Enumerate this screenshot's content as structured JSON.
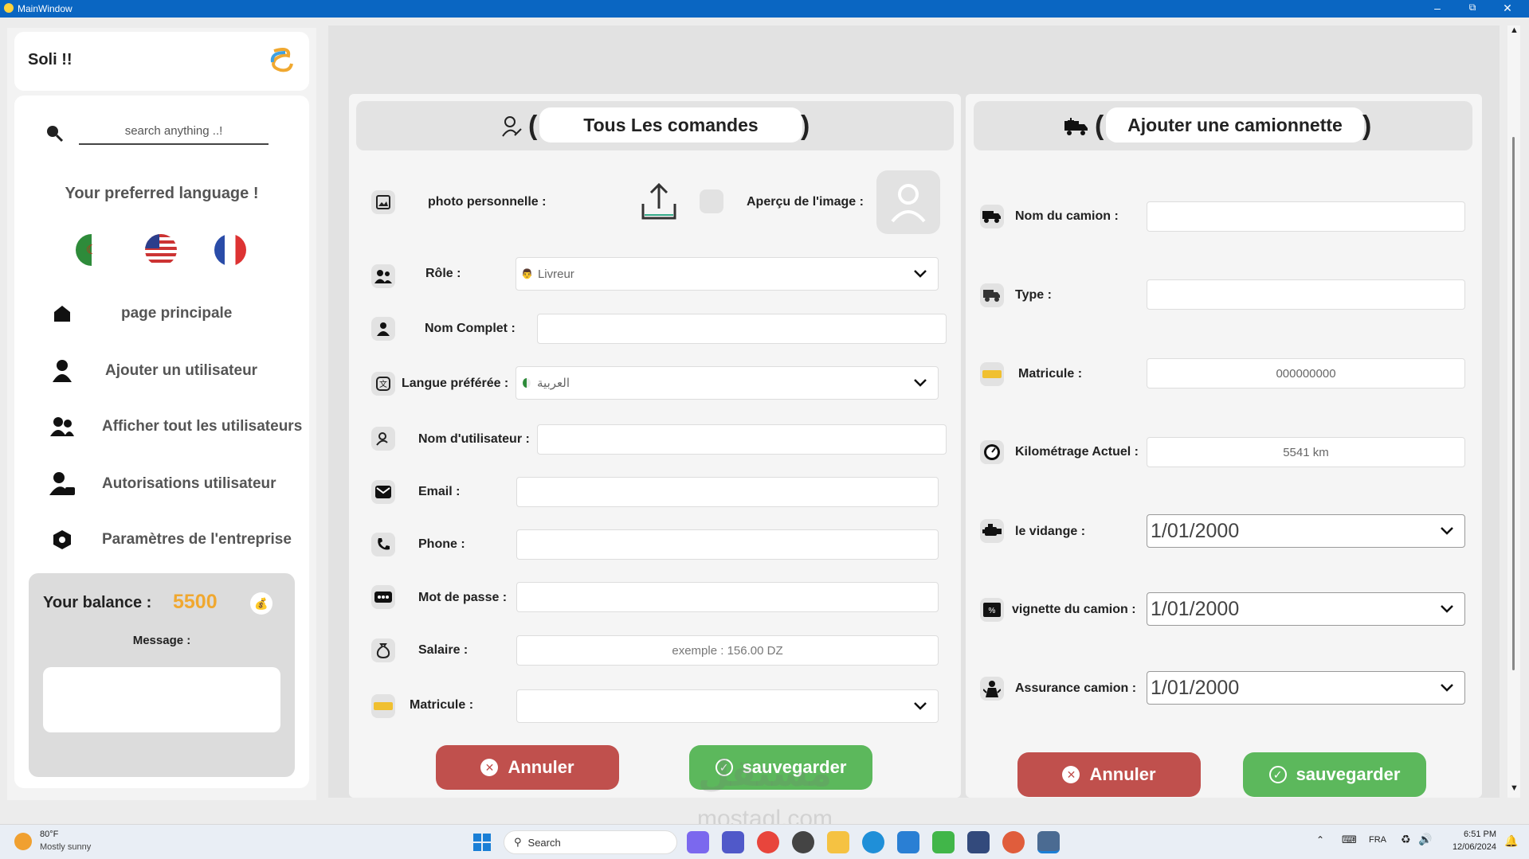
{
  "window": {
    "title": "MainWindow"
  },
  "sidebar": {
    "app_name": "Soli !!",
    "search_placeholder": "search anything ..!",
    "language_title": "Your preferred language !",
    "menu": [
      {
        "label": "page principale",
        "icon": "home-icon"
      },
      {
        "label": "Ajouter un utilisateur",
        "icon": "add-user-icon"
      },
      {
        "label": "Afficher tout les utilisateurs",
        "icon": "users-icon"
      },
      {
        "label": "Autorisations utilisateur",
        "icon": "user-lock-icon"
      },
      {
        "label": "Paramètres de l'entreprise",
        "icon": "settings-icon"
      }
    ],
    "balance_label": "Your balance :",
    "balance_value": "5500",
    "message_label": "Message :"
  },
  "left_panel": {
    "title": "Tous Les comandes",
    "photo_label": "photo personnelle :",
    "preview_label": "Aperçu de l'image :",
    "role_label": "Rôle :",
    "role_value": "Livreur",
    "fullname_label": "Nom Complet :",
    "language_label": "Langue préférée :",
    "language_value": "العربية",
    "username_label": "Nom d'utilisateur :",
    "email_label": "Email :",
    "phone_label": "Phone :",
    "password_label": "Mot de passe :",
    "salary_label": "Salaire :",
    "salary_placeholder": "exemple : 156.00 DZ",
    "matricule_label": "Matricule :",
    "cancel": "Annuler",
    "save": "sauvegarder"
  },
  "right_panel": {
    "title": "Ajouter une camionnette",
    "truck_name_label": "Nom du camion :",
    "type_label": "Type :",
    "matricule_label": "Matricule :",
    "matricule_placeholder": "000000000",
    "km_label": "Kilométrage Actuel :",
    "km_value": "5541 km",
    "oil_label": "le vidange :",
    "oil_date": "1/01/2000",
    "vignette_label": "vignette du camion :",
    "vignette_date": "1/01/2000",
    "insurance_label": "Assurance camion :",
    "insurance_date": "1/01/2000",
    "cancel": "Annuler",
    "save": "sauvegarder"
  },
  "taskbar": {
    "weather_temp": "80°F",
    "weather_desc": "Mostly sunny",
    "search_label": "Search",
    "lang": "FRA",
    "time": "6:51 PM",
    "date": "12/06/2024"
  },
  "watermark": {
    "text": "مستقل",
    "sub": "mostaql.com"
  },
  "colors": {
    "titlebar": "#0a66c2",
    "accent": "#f0a830",
    "red": "#c0504d",
    "green": "#5cb85c"
  }
}
